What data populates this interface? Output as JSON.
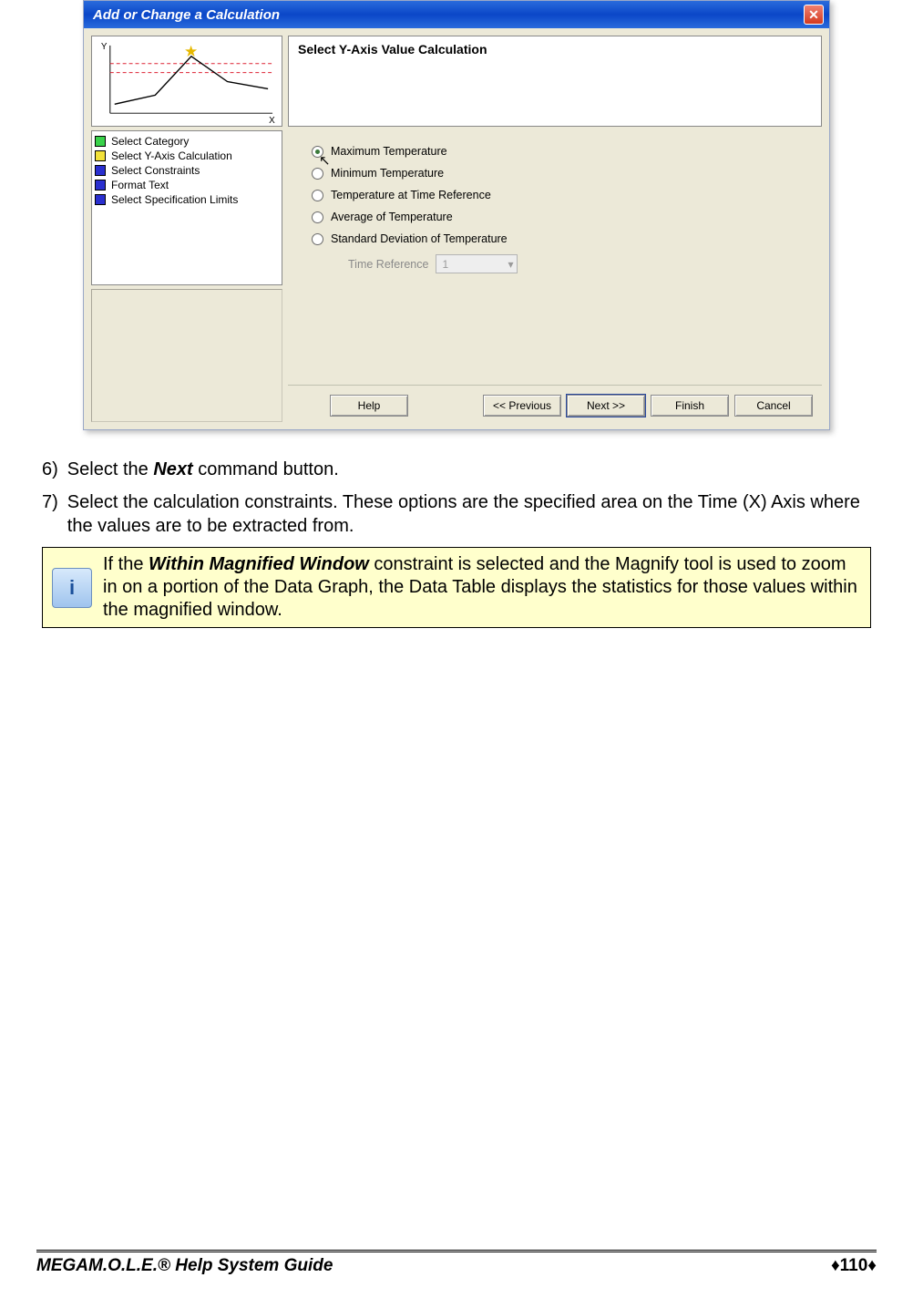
{
  "dialog": {
    "title": "Add or Change a Calculation",
    "heading": "Select Y-Axis Value Calculation",
    "nav_items": [
      {
        "label": "Select Category",
        "color": "#39d24a"
      },
      {
        "label": "Select Y-Axis Calculation",
        "color": "#f2e13a"
      },
      {
        "label": "Select Constraints",
        "color": "#2a2fcf"
      },
      {
        "label": "Format Text",
        "color": "#2a2fcf"
      },
      {
        "label": "Select Specification Limits",
        "color": "#2a2fcf"
      }
    ],
    "radios": [
      {
        "label": "Maximum Temperature",
        "checked": true,
        "cursor": true
      },
      {
        "label": "Minimum Temperature",
        "checked": false
      },
      {
        "label": "Temperature at Time Reference",
        "checked": false
      },
      {
        "label": "Average of Temperature",
        "checked": false
      },
      {
        "label": "Standard Deviation of Temperature",
        "checked": false
      }
    ],
    "time_reference_label": "Time Reference",
    "time_reference_value": "1",
    "buttons": {
      "help": "Help",
      "previous": "<< Previous",
      "next": "Next >>",
      "finish": "Finish",
      "cancel": "Cancel"
    },
    "axis_x": "X",
    "axis_y": "Y"
  },
  "doc": {
    "step6_num": "6)",
    "step6_a": "Select the ",
    "step6_bold": "Next",
    "step6_b": " command button.",
    "step7_num": "7)",
    "step7_text": "Select the calculation constraints. These options are the specified area on the Time (X) Axis where the values are to be extracted from.",
    "note_a": "If the ",
    "note_bold": "Within Magnified Window",
    "note_b": " constraint is selected and the Magnify tool is used to zoom in on a portion of the Data Graph, the Data Table displays the statistics for those values within the magnified window."
  },
  "footer": {
    "left_prefix": "MEGA",
    "left_rest": "M.O.L.E.® Help System Guide",
    "page": "110"
  }
}
